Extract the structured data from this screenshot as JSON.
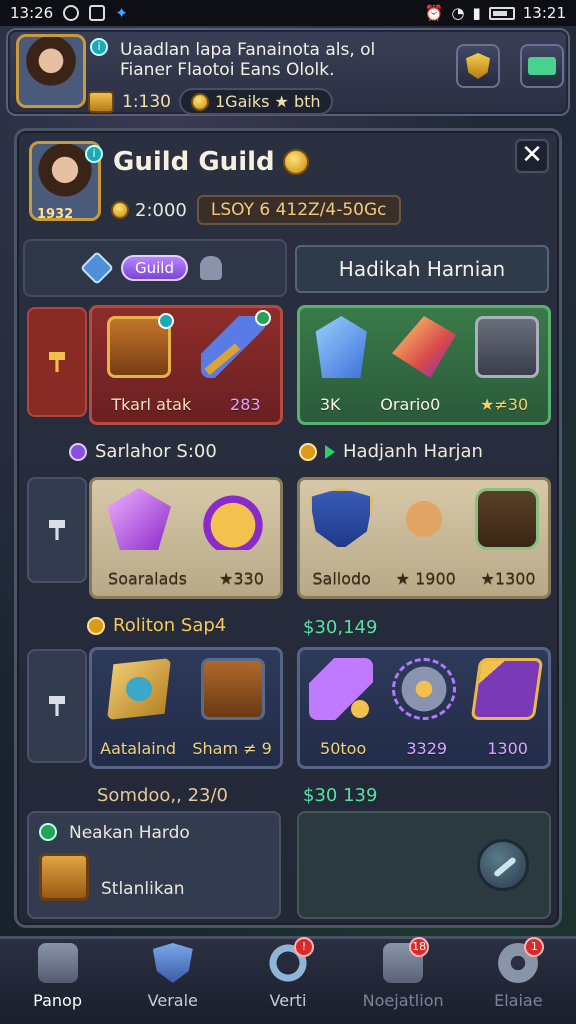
{
  "status_bar": {
    "time_left": "13:26",
    "time_right": "13:21"
  },
  "banner": {
    "title_line1": "Uaadlan lapa Fanainota als, ol",
    "title_line2": "Fianer Flaotoi Eans Ololk.",
    "currency1": "1:130",
    "currency2": "1Gaiks ★ bth"
  },
  "profile": {
    "title": "Guild Guild",
    "level": "1932",
    "gold": "2:000",
    "tag": "LSOY 6 412Z/4-50Gc"
  },
  "tabs": {
    "guild_chip": "Guild",
    "right_header": "Hadikah Harnian"
  },
  "row1": {
    "left_labels": [
      "Tkarl atak",
      "283"
    ],
    "right_labels": [
      "3K",
      "Orario0",
      "★≠30"
    ]
  },
  "section1": {
    "left": "Sarlahor S:00",
    "right": "Hadjanh Harjan"
  },
  "row2": {
    "left_labels": [
      "Soaralads",
      "★330"
    ],
    "right_labels": [
      "Sallodo",
      "★ 1900",
      "★1300"
    ]
  },
  "section2": {
    "left": "Roliton Sap4",
    "right": "$30,149"
  },
  "row3": {
    "left_labels": [
      "Aatalaind",
      "Sham ≠ 9"
    ],
    "right_labels": [
      "50too",
      "3329",
      "1300"
    ]
  },
  "section3": {
    "left": "Somdoo,, 23/0",
    "right": "$30 139"
  },
  "bottom": {
    "title": "Neakan Hardo",
    "subtitle": "Stlanlikan"
  },
  "nav": {
    "items": [
      {
        "label": "Panop",
        "badge": ""
      },
      {
        "label": "Verale",
        "badge": ""
      },
      {
        "label": "Verti",
        "badge": "!"
      },
      {
        "label": "Noejatlion",
        "badge": "18"
      },
      {
        "label": "Elaiae",
        "badge": "1"
      }
    ]
  },
  "colors": {
    "accent_gold": "#f4c95a",
    "accent_green": "#55e0a0",
    "guild_purple": "#9a5af0"
  }
}
